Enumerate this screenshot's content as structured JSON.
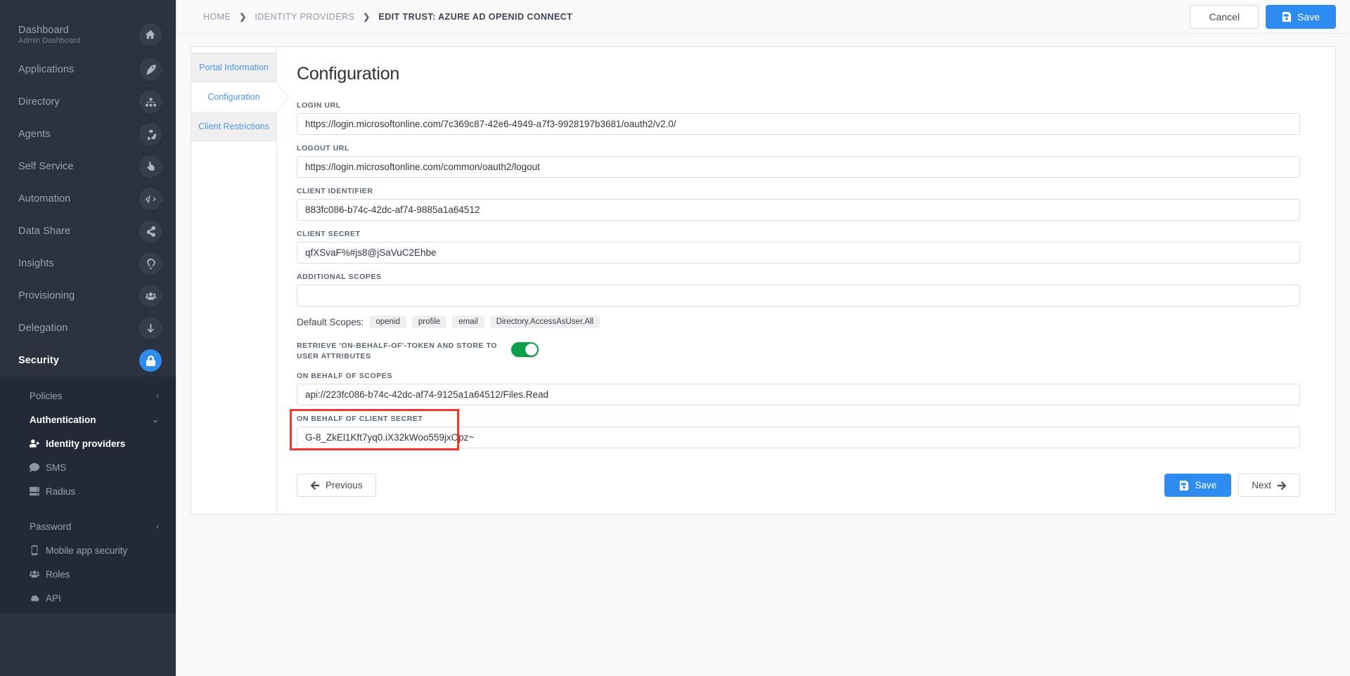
{
  "sidebar": {
    "dashboard": {
      "label": "Dashboard",
      "subtitle": "Admin Dashboard",
      "icon": "home-icon"
    },
    "items": [
      {
        "label": "Applications",
        "chevron": "‹",
        "icon": "rocket-icon"
      },
      {
        "label": "Directory",
        "chevron": "‹",
        "icon": "sitemap-icon"
      },
      {
        "label": "Agents",
        "chevron": "",
        "icon": "cubes-icon"
      },
      {
        "label": "Self Service",
        "chevron": "‹",
        "icon": "hand-pointer-icon"
      },
      {
        "label": "Automation",
        "chevron": "‹",
        "icon": "code-icon"
      },
      {
        "label": "Data Share",
        "chevron": "",
        "icon": "share-icon"
      },
      {
        "label": "Insights",
        "chevron": "‹",
        "icon": "lightbulb-icon"
      },
      {
        "label": "Provisioning",
        "chevron": "‹",
        "icon": "users-icon"
      },
      {
        "label": "Delegation",
        "chevron": "‹",
        "icon": "arrow-turn-down-icon"
      },
      {
        "label": "Security",
        "chevron": "⌄",
        "icon": "lock-icon",
        "active": true
      }
    ],
    "submenu": [
      {
        "label": "Policies",
        "type": "group",
        "chevron": "‹"
      },
      {
        "label": "Authentication",
        "type": "group",
        "chevron": "⌄",
        "open": true
      },
      {
        "label": "Identity providers",
        "type": "leaf",
        "icon": "user-plus-icon",
        "selected": true
      },
      {
        "label": "SMS",
        "type": "leaf",
        "icon": "comment-icon"
      },
      {
        "label": "Radius",
        "type": "leaf",
        "icon": "server-icon"
      },
      {
        "label": "Password",
        "type": "group",
        "chevron": "‹"
      },
      {
        "label": "Mobile app security",
        "type": "leaf",
        "icon": "mobile-icon"
      },
      {
        "label": "Roles",
        "type": "leaf",
        "icon": "users-icon"
      },
      {
        "label": "API",
        "type": "leaf",
        "icon": "cloud-icon"
      }
    ]
  },
  "topbar": {
    "breadcrumbs": [
      "HOME",
      "IDENTITY PROVIDERS",
      "EDIT TRUST: AZURE AD OPENID CONNECT"
    ],
    "separator": "❯",
    "cancel_label": "Cancel",
    "save_label": "Save"
  },
  "tabs": [
    {
      "label": "Portal Information",
      "active": false
    },
    {
      "label": "Configuration",
      "active": true
    },
    {
      "label": "Client Restrictions",
      "active": false
    }
  ],
  "form": {
    "title": "Configuration",
    "fields": [
      {
        "label": "LOGIN URL",
        "value": "https://login.microsoftonline.com/7c369c87-42e6-4949-a7f3-9928197b3681/oauth2/v2.0/",
        "name": "login-url"
      },
      {
        "label": "LOGOUT URL",
        "value": "https://login.microsoftonline.com/common/oauth2/logout",
        "name": "logout-url"
      },
      {
        "label": "CLIENT IDENTIFIER",
        "value": "883fc086-b74c-42dc-af74-9885a1a64512",
        "name": "client-identifier"
      },
      {
        "label": "CLIENT SECRET",
        "value": "qfXSvaF%#js8@jSaVuC2Ehbe",
        "name": "client-secret"
      },
      {
        "label": "ADDITIONAL SCOPES",
        "value": "",
        "name": "additional-scopes"
      }
    ],
    "default_scopes_label": "Default Scopes:",
    "default_scopes": [
      "openid",
      "profile",
      "email",
      "Directory.AccessAsUser.All"
    ],
    "toggle_label": "RETRIEVE 'ON-BEHALF-OF'-TOKEN AND STORE TO USER ATTRIBUTES",
    "toggle_on": true,
    "obo_scopes": {
      "label": "ON BEHALF OF SCOPES",
      "value": "api://223fc086-b74c-42dc-af74-9125a1a64512/Files.Read"
    },
    "obo_client_secret": {
      "label": "ON BEHALF OF CLIENT SECRET",
      "value": "G-8_ZkEl1Kft7yq0.iX32kWoo559jxOpz~"
    },
    "previous_label": "Previous",
    "save_label": "Save",
    "next_label": "Next"
  },
  "colors": {
    "sidebar_bg": "#2b313e",
    "submenu_bg": "#232936",
    "accent_blue": "#2e8bef",
    "toggle_green": "#0ba04a",
    "highlight_red": "#f4362f",
    "tab_link": "#4f96e8"
  }
}
